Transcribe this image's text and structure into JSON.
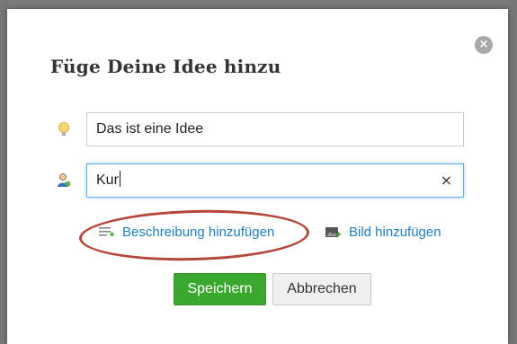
{
  "dialog": {
    "title": "Füge Deine Idee hinzu",
    "close_label": "×"
  },
  "fields": {
    "idea_value": "Das ist eine Idee",
    "person_value": "Kur",
    "clear_label": "×"
  },
  "links": {
    "add_description": "Beschreibung hinzufügen",
    "add_image": "Bild hinzufügen"
  },
  "buttons": {
    "save": "Speichern",
    "cancel": "Abbrechen"
  },
  "colors": {
    "save_button": "#3aa82e",
    "link": "#1f7fc4",
    "annotation": "#b5473a",
    "focus_border": "#66afe9"
  },
  "icons": {
    "idea": "lightbulb-icon",
    "person": "user-icon",
    "description": "add-description-icon",
    "image": "add-image-icon",
    "close": "close-icon"
  }
}
